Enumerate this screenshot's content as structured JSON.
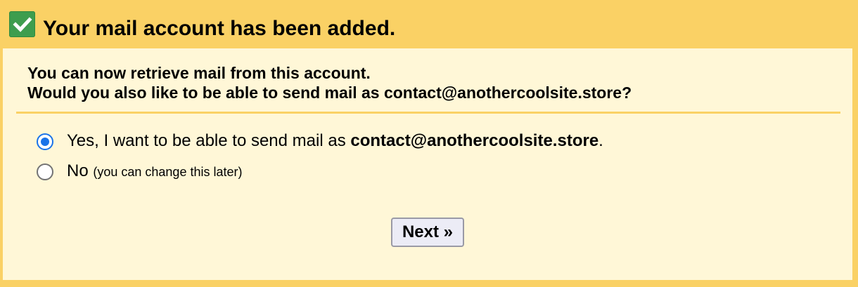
{
  "header": {
    "icon": "check-icon",
    "title": "Your mail account has been added.",
    "background_color": "#fad165",
    "check_color": "#3e9d4e"
  },
  "panel": {
    "background_color": "#fff7d7",
    "question_line_1": "You can now retrieve mail from this account.",
    "question_line_2": "Would you also like to be able to send mail as contact@anothercoolsite.store?"
  },
  "options": {
    "yes": {
      "text_before": "Yes, I want to be able to send mail as ",
      "email": "contact@anothercoolsite.store",
      "text_after": ".",
      "selected": true
    },
    "no": {
      "label": "No",
      "hint": "(you can change this later)",
      "selected": false
    }
  },
  "next_button": {
    "label": "Next »"
  }
}
